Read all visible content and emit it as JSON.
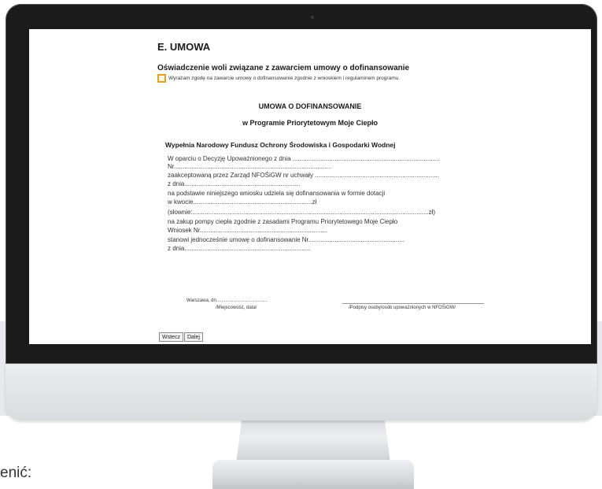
{
  "form": {
    "section_title": "E.  UMOWA",
    "declaration_heading": "Oświadczenie woli związane z zawarciem umowy o dofinansowanie",
    "consent_text": "Wyrażam zgodę na zawarcie umowy o dofinansowanie zgodnie z wnioskiem i regulaminem programu.",
    "contract_title": "UMOWA O DOFINANSOWANIE",
    "contract_subtitle": "w Programie Priorytetowym Moje Ciepło",
    "filled_by": "Wypełnia Narodowy Fundusz Ochrony Środowiska i Gospodarki Wodnej",
    "lines": [
      "W oparciu o Decyzję Upoważnionego    z dnia ....................................................................................",
      "Nr..........................................................................................",
      "zaakceptowaną przez Zarząd NFOŚiGW nr uchwały      .......................................................................",
      "z dnia..................................................................",
      "na podstawie niniejszego wniosku udziela się dofinansowania w formie dotacji",
      "w kwocie....................................................................zł",
      "(słownie:.......................................................................................................................................zł)",
      "na zakup pompy ciepła zgodnie z zasadami Programu Priorytetowego Moje Ciepło",
      "Wniosek   Nr.........................................................................",
      "stanowi jednocześnie umowę o dofinansowanie     Nr.......................................................",
      "z dnia........................................................................"
    ],
    "place_date_prefix": "Warszawa, dn.......................................",
    "place_date_caption": "/Miejscowość, data/",
    "signatures_caption": "/Podpisy osoby/osób upoważnionych w NFOŚiGW/"
  },
  "buttons": {
    "back": "Wstecz",
    "next": "Dalej"
  },
  "caption": "enić:",
  "colors": {
    "checkbox_border": "#e8a020",
    "monitor_bezel": "#1b1b1b",
    "band": "#e7eaed"
  }
}
